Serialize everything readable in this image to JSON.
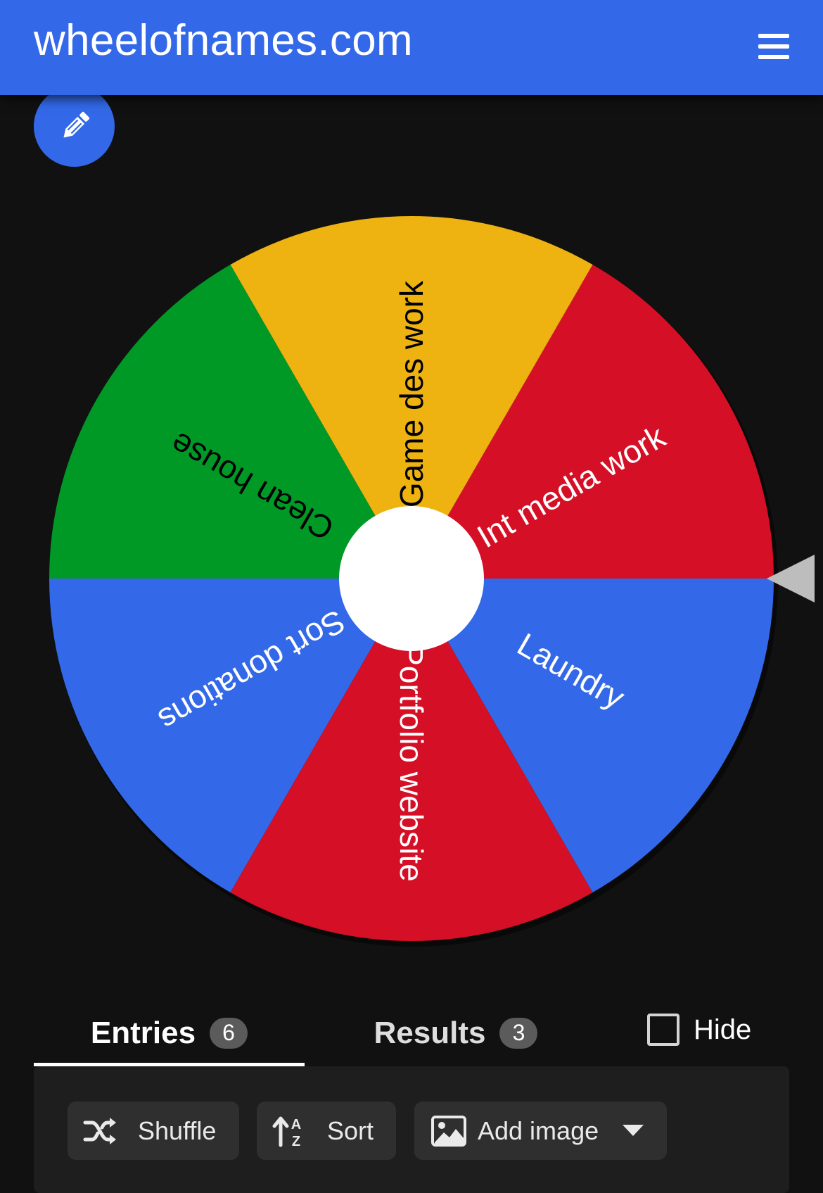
{
  "header": {
    "title": "wheelofnames.com",
    "menu_icon": "hamburger-menu-icon"
  },
  "edit_button": {
    "icon": "pencil-icon"
  },
  "wheel": {
    "segments": [
      {
        "label": "Int media work",
        "color": "#d50f25",
        "text_color": "#ffffff"
      },
      {
        "label": "Game des work",
        "color": "#eeb211",
        "text_color": "#000000"
      },
      {
        "label": "Clean house",
        "color": "#009925",
        "text_color": "#000000"
      },
      {
        "label": "Sort donations",
        "color": "#3369e8",
        "text_color": "#ffffff"
      },
      {
        "label": "Portfolio website",
        "color": "#d50f25",
        "text_color": "#ffffff"
      },
      {
        "label": "Laundry",
        "color": "#3369e8",
        "text_color": "#ffffff"
      }
    ],
    "pointer_color": "#bdbdbd",
    "center_color": "#ffffff"
  },
  "tabs": {
    "entries": {
      "label": "Entries",
      "count": "6"
    },
    "results": {
      "label": "Results",
      "count": "3"
    },
    "hide": {
      "label": "Hide",
      "checked": false
    }
  },
  "toolbar": {
    "shuffle_label": "Shuffle",
    "sort_label": "Sort",
    "add_image_label": "Add image"
  },
  "colors": {
    "accent": "#3369e8",
    "background": "#111111",
    "panel": "#1e1e1e",
    "button": "#2f2f2f"
  }
}
